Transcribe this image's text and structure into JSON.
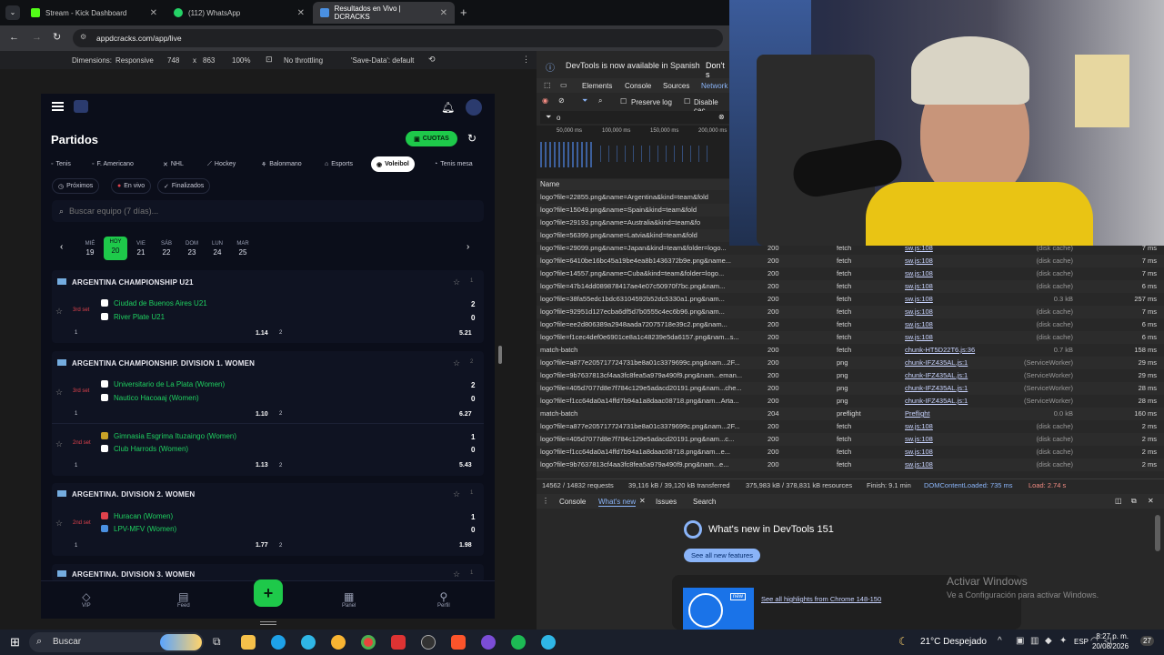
{
  "browser": {
    "tabs": [
      {
        "label": "Stream - Kick Dashboard"
      },
      {
        "label": "(112) WhatsApp"
      },
      {
        "label": "Resultados en Vivo | DCRACKS"
      }
    ],
    "url": "appdcracks.com/app/live",
    "new_tab": "+"
  },
  "device_toolbar": {
    "dimensions_label": "Dimensions:",
    "dimensions_mode": "Responsive",
    "width": "748",
    "x": "x",
    "height": "863",
    "zoom": "100%",
    "throttling": "No throttling",
    "save_data": "'Save-Data': default"
  },
  "app": {
    "title": "Partidos",
    "cuotas_label": "CUOTAS",
    "sports": [
      "Tenis",
      "F. Americano",
      "NHL",
      "Hockey",
      "Balonmano",
      "Esports",
      "Voleibol",
      "Tenis mesa"
    ],
    "filters": [
      "Próximos",
      "En vivo",
      "Finalizados"
    ],
    "search_placeholder": "Buscar equipo (7 días)...",
    "days": [
      {
        "d": "MIÉ",
        "n": "19"
      },
      {
        "d": "HOY",
        "n": "20"
      },
      {
        "d": "VIE",
        "n": "21"
      },
      {
        "d": "SÁB",
        "n": "22"
      },
      {
        "d": "DOM",
        "n": "23"
      },
      {
        "d": "LUN",
        "n": "24"
      },
      {
        "d": "MAR",
        "n": "25"
      }
    ],
    "leagues": [
      {
        "name": "ARGENTINA CHAMPIONSHIP U21",
        "count": "1",
        "matches": [
          {
            "set": "3rd set",
            "home": "Ciudad de Buenos Aires U21",
            "away": "River Plate U21",
            "hs": "2",
            "as": "0",
            "o1": "1.14",
            "o2": "5.21",
            "l1": "1",
            "l2": "2"
          }
        ]
      },
      {
        "name": "ARGENTINA CHAMPIONSHIP. DIVISION 1. WOMEN",
        "count": "2",
        "matches": [
          {
            "set": "3rd set",
            "home": "Universitario de La Plata (Women)",
            "away": "Nautico Hacoaaj (Women)",
            "hs": "2",
            "as": "0",
            "o1": "1.10",
            "o2": "6.27",
            "l1": "1",
            "l2": "2"
          },
          {
            "set": "2nd set",
            "home": "Gimnasia Esgrima Ituzaingo (Women)",
            "away": "Club Harrods (Women)",
            "hs": "1",
            "as": "0",
            "o1": "1.13",
            "o2": "5.43",
            "l1": "1",
            "l2": "2"
          }
        ]
      },
      {
        "name": "ARGENTINA. DIVISION 2. WOMEN",
        "count": "1",
        "matches": [
          {
            "set": "2nd set",
            "home": "Huracan (Women)",
            "away": "LPV-MFV (Women)",
            "hs": "1",
            "as": "0",
            "o1": "1.77",
            "o2": "1.98",
            "l1": "1",
            "l2": "2"
          }
        ]
      },
      {
        "name": "ARGENTINA. DIVISION 3. WOMEN",
        "count": "1",
        "matches": []
      }
    ],
    "bottom_nav": [
      "VIP",
      "Feed",
      "+",
      "Panel",
      "Perfil"
    ]
  },
  "devtools": {
    "banner": "DevTools is now available in Spanish",
    "banner_btn": "Don't s",
    "tabs": [
      "Elements",
      "Console",
      "Sources",
      "Network"
    ],
    "preserve_log": "Preserve log",
    "disable_cache": "Disable cac",
    "filter_value": "o",
    "timeline": [
      "50,000 ms",
      "100,000 ms",
      "150,000 ms",
      "200,000 ms"
    ],
    "name_header": "Name",
    "rows": [
      {
        "name": "logo?file=22855.png&name=Argentina&kind=team&fold",
        "status": "",
        "type": "",
        "init": "",
        "size": "",
        "time": ""
      },
      {
        "name": "logo?file=15049.png&name=Spain&kind=team&fold",
        "status": "",
        "type": "",
        "init": "",
        "size": "",
        "time": ""
      },
      {
        "name": "logo?file=29193.png&name=Australia&kind=team&fo",
        "status": "",
        "type": "",
        "init": "",
        "size": "",
        "time": ""
      },
      {
        "name": "logo?file=56399.png&name=Latvia&kind=team&fold",
        "status": "",
        "type": "",
        "init": "",
        "size": "",
        "time": ""
      },
      {
        "name": "logo?file=29099.png&name=Japan&kind=team&folder=logo...",
        "status": "200",
        "type": "fetch",
        "init": "sw.js:108",
        "size": "(disk cache)",
        "time": "7 ms"
      },
      {
        "name": "logo?file=6410be16bc45a19be4ea8b1436372b9e.png&name...",
        "status": "200",
        "type": "fetch",
        "init": "sw.js:108",
        "size": "(disk cache)",
        "time": "7 ms"
      },
      {
        "name": "logo?file=14557.png&name=Cuba&kind=team&folder=logo...",
        "status": "200",
        "type": "fetch",
        "init": "sw.js:108",
        "size": "(disk cache)",
        "time": "7 ms"
      },
      {
        "name": "logo?file=47b14dd089878417ae4e07c50970f7bc.png&nam...",
        "status": "200",
        "type": "fetch",
        "init": "sw.js:108",
        "size": "(disk cache)",
        "time": "6 ms"
      },
      {
        "name": "logo?file=38fa55edc1bdc63104592b52dc5330a1.png&nam...",
        "status": "200",
        "type": "fetch",
        "init": "sw.js:108",
        "size": "0.3 kB",
        "time": "257 ms"
      },
      {
        "name": "logo?file=92951d127ecba6df5d7b0555c4ec6b96.png&nam...",
        "status": "200",
        "type": "fetch",
        "init": "sw.js:108",
        "size": "(disk cache)",
        "time": "7 ms"
      },
      {
        "name": "logo?file=ee2d806389a2948aada72075718e39c2.png&nam...",
        "status": "200",
        "type": "fetch",
        "init": "sw.js:108",
        "size": "(disk cache)",
        "time": "6 ms"
      },
      {
        "name": "logo?file=f1cec4def0e6901ce8a1c48239e5da6157.png&nam...s...",
        "status": "200",
        "type": "fetch",
        "init": "sw.js:108",
        "size": "(disk cache)",
        "time": "6 ms"
      },
      {
        "name": "match-batch",
        "status": "200",
        "type": "fetch",
        "init": "chunk-HT5D22T6.js:36",
        "size": "0.7 kB",
        "time": "158 ms"
      },
      {
        "name": "logo?file=a877e205717724731be8a01c3379699c.png&nam...2F...",
        "status": "200",
        "type": "png",
        "init": "chunk-IFZ435AL.js:1",
        "size": "(ServiceWorker)",
        "time": "29 ms"
      },
      {
        "name": "logo?file=9b7637813cf4aa3fc8fea5a979a490f9.png&nam...eman...",
        "status": "200",
        "type": "png",
        "init": "chunk-IFZ435AL.js:1",
        "size": "(ServiceWorker)",
        "time": "29 ms"
      },
      {
        "name": "logo?file=405d7077d8e7f784c129e5adacd20191.png&nam...che...",
        "status": "200",
        "type": "png",
        "init": "chunk-IFZ435AL.js:1",
        "size": "(ServiceWorker)",
        "time": "28 ms"
      },
      {
        "name": "logo?file=f1cc64da0a14ffd7b94a1a8daac08718.png&nam...Arta...",
        "status": "200",
        "type": "png",
        "init": "chunk-IFZ435AL.js:1",
        "size": "(ServiceWorker)",
        "time": "28 ms"
      },
      {
        "name": "match-batch",
        "status": "204",
        "type": "preflight",
        "init": "Preflight",
        "size": "0.0 kB",
        "time": "160 ms"
      },
      {
        "name": "logo?file=a877e205717724731be8a01c3379699c.png&nam...2F...",
        "status": "200",
        "type": "fetch",
        "init": "sw.js:108",
        "size": "(disk cache)",
        "time": "2 ms"
      },
      {
        "name": "logo?file=405d7077d8e7f784c129e5adacd20191.png&nam...c...",
        "status": "200",
        "type": "fetch",
        "init": "sw.js:108",
        "size": "(disk cache)",
        "time": "2 ms"
      },
      {
        "name": "logo?file=f1cc64da0a14ffd7b94a1a8daac08718.png&nam...e...",
        "status": "200",
        "type": "fetch",
        "init": "sw.js:108",
        "size": "(disk cache)",
        "time": "2 ms"
      },
      {
        "name": "logo?file=9b7637813cf4aa3fc8fea5a979a490f9.png&nam...e...",
        "status": "200",
        "type": "fetch",
        "init": "sw.js:108",
        "size": "(disk cache)",
        "time": "2 ms"
      }
    ],
    "summary": {
      "requests": "14562 / 14832 requests",
      "transferred": "39,116 kB / 39,120 kB transferred",
      "resources": "375,983 kB / 378,831 kB resources",
      "finish": "Finish: 9.1 min",
      "dcl": "DOMContentLoaded: 735 ms",
      "load": "Load: 2.74 s"
    },
    "drawer_tabs": [
      "Console",
      "What's new",
      "Issues",
      "Search"
    ],
    "whatsnew_title": "What's new in DevTools 151",
    "see_all": "See all new features",
    "highlights": "See all highlights from Chrome 148-150",
    "new_badge": "new"
  },
  "windows_watermark": {
    "title": "Activar Windows",
    "subtitle": "Ve a Configuración para activar Windows."
  },
  "taskbar": {
    "search": "Buscar",
    "weather": "21°C  Despejado",
    "lang": "ESP",
    "time": "8:27 p. m.",
    "date": "20/08/2026",
    "notif": "27"
  }
}
